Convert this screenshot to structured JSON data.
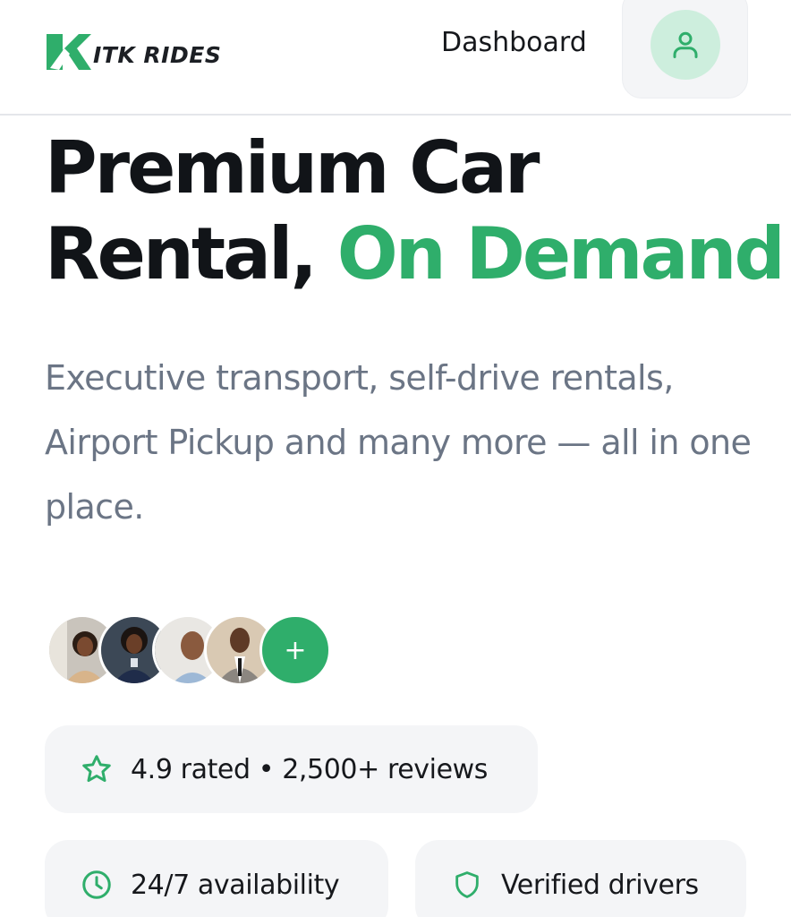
{
  "header": {
    "logo_text": "ITK RIDES",
    "nav_dashboard": "Dashboard",
    "colors": {
      "brand_green": "#2fae6b",
      "user_circle_bg": "#cdeedd"
    }
  },
  "hero": {
    "title_line1": "Premium Car",
    "title_line2_plain": "Rental, ",
    "title_line2_accent": "On Demand",
    "subtitle": "Executive transport, self-drive rentals, Airport Pickup and many more — all in one place."
  },
  "social_proof": {
    "avatars": [
      {
        "name": "avatar-1",
        "icon": "person-photo"
      },
      {
        "name": "avatar-2",
        "icon": "person-photo"
      },
      {
        "name": "avatar-3",
        "icon": "person-photo"
      },
      {
        "name": "avatar-4",
        "icon": "person-photo"
      }
    ],
    "plus_label": "+"
  },
  "features": {
    "rating": {
      "text": "4.9 rated • 2,500+ reviews",
      "icon": "star-icon"
    },
    "availability": {
      "text": "24/7 availability",
      "icon": "clock-icon"
    },
    "drivers": {
      "text": "Verified drivers",
      "icon": "shield-icon"
    }
  }
}
